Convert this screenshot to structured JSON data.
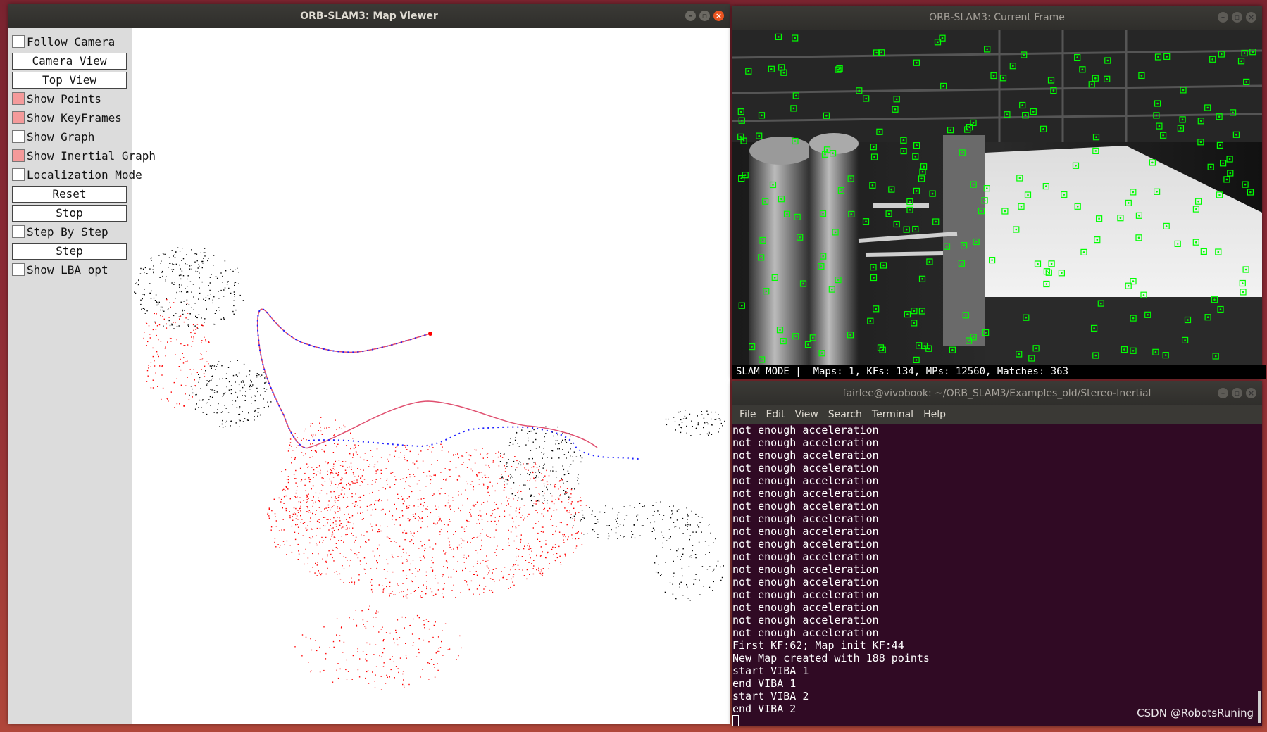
{
  "map_viewer": {
    "title": "ORB-SLAM3: Map Viewer",
    "panel": {
      "follow_camera": {
        "label": "Follow Camera",
        "checked": false
      },
      "camera_view": "Camera View",
      "top_view": "Top View",
      "show_points": {
        "label": "Show Points",
        "checked": true
      },
      "show_keyframes": {
        "label": "Show KeyFrames",
        "checked": true
      },
      "show_graph": {
        "label": "Show Graph",
        "checked": false
      },
      "show_inertial_graph": {
        "label": "Show Inertial Graph",
        "checked": true
      },
      "localization_mode": {
        "label": "Localization Mode",
        "checked": false
      },
      "reset": "Reset",
      "stop": "Stop",
      "step_by_step": {
        "label": "Step By Step",
        "checked": false
      },
      "step": "Step",
      "show_lba_opt": {
        "label": "Show LBA opt",
        "checked": false
      }
    }
  },
  "current_frame": {
    "title": "ORB-SLAM3: Current Frame",
    "status": "SLAM MODE |  Maps: 1, KFs: 134, MPs: 12560, Matches: 363"
  },
  "terminal": {
    "title": "fairlee@vivobook: ~/ORB_SLAM3/Examples_old/Stereo-Inertial",
    "menu": [
      "File",
      "Edit",
      "View",
      "Search",
      "Terminal",
      "Help"
    ],
    "lines": [
      "not enough acceleration",
      "not enough acceleration",
      "not enough acceleration",
      "not enough acceleration",
      "not enough acceleration",
      "not enough acceleration",
      "not enough acceleration",
      "not enough acceleration",
      "not enough acceleration",
      "not enough acceleration",
      "not enough acceleration",
      "not enough acceleration",
      "not enough acceleration",
      "not enough acceleration",
      "not enough acceleration",
      "not enough acceleration",
      "not enough acceleration",
      "First KF:62; Map init KF:44",
      "New Map created with 188 points",
      "start VIBA 1",
      "end VIBA 1",
      "start VIBA 2",
      "end VIBA 2"
    ]
  },
  "watermark": "CSDN @RobotsRuning",
  "colors": {
    "feature_green": "#00ff00",
    "map_point_red": "#ff0000",
    "map_point_black": "#000000",
    "trajectory_blue": "#0000ff",
    "checkbox_on": "#f49a9a",
    "terminal_bg": "#300a24"
  }
}
